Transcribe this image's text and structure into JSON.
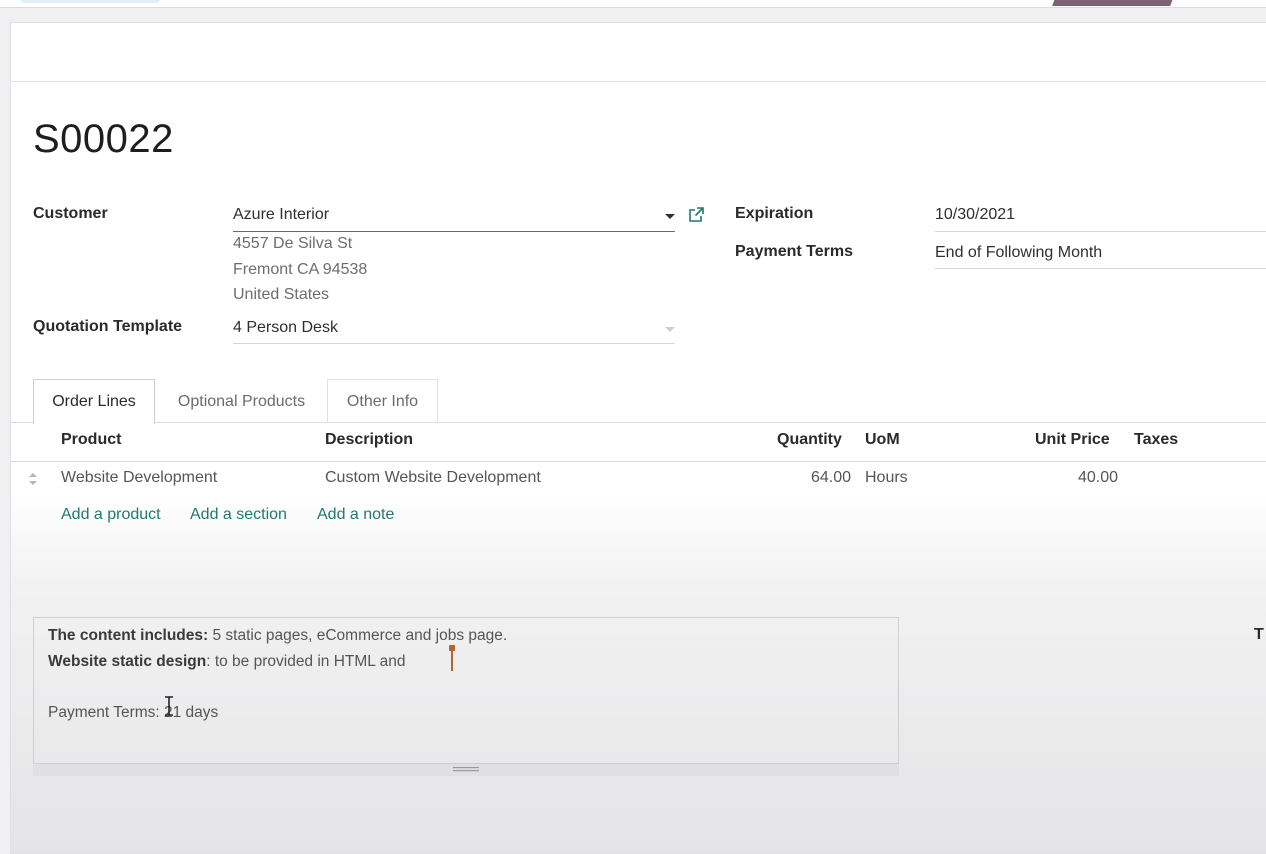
{
  "record": {
    "title": "S00022"
  },
  "customer": {
    "label": "Customer",
    "value": "Azure Interior",
    "address_line1": "4557 De Silva St",
    "address_line2": "Fremont CA 94538",
    "address_line3": "United States"
  },
  "quotation_template": {
    "label": "Quotation Template",
    "value": "4 Person Desk"
  },
  "expiration": {
    "label": "Expiration",
    "value": "10/30/2021"
  },
  "payment_terms": {
    "label": "Payment Terms",
    "value": "End of Following Month"
  },
  "tabs": [
    {
      "label": "Order Lines",
      "active": true
    },
    {
      "label": "Optional Products",
      "active": false
    },
    {
      "label": "Other Info",
      "active": false
    }
  ],
  "order_lines": {
    "columns": {
      "product": "Product",
      "description": "Description",
      "quantity": "Quantity",
      "uom": "UoM",
      "unit_price": "Unit Price",
      "taxes": "Taxes"
    },
    "rows": [
      {
        "product": "Website Development",
        "description": "Custom Website Development",
        "quantity": "64.00",
        "uom": "Hours",
        "unit_price": "40.00",
        "taxes": ""
      }
    ],
    "actions": {
      "add_product": "Add a product",
      "add_section": "Add a section",
      "add_note": "Add a note"
    }
  },
  "note": {
    "line1_bold": "The content includes:",
    "line1_rest": " 5 static pages, eCommerce and jobs page.",
    "line2_bold": "Website static design",
    "line2_rest": ": to be provided in HTML and",
    "line3": "Payment Terms: 21 days"
  },
  "side_label_partial": "T",
  "colors": {
    "link": "#1e7a6e",
    "text_cursor": "#b2662a",
    "header_accent": "#7c6276"
  }
}
